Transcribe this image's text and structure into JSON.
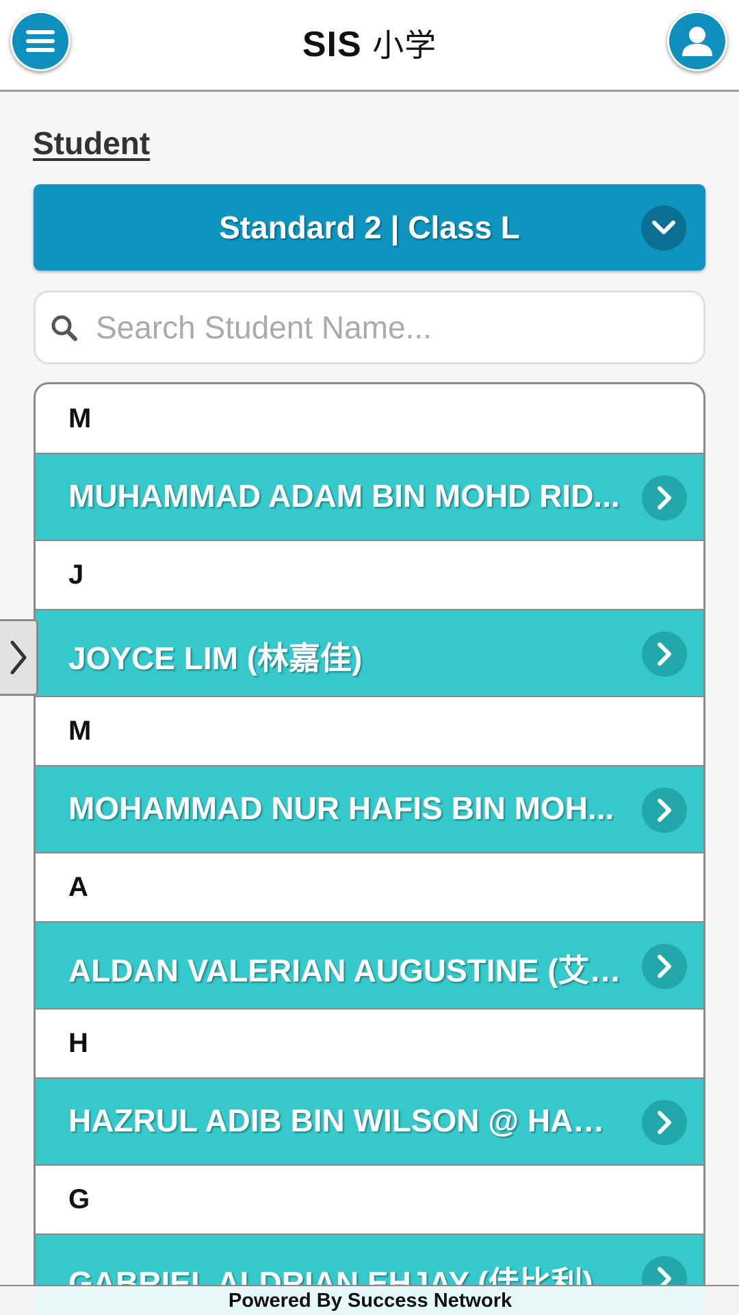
{
  "header": {
    "title_sis": "SIS",
    "title_cn": "小学",
    "menu_icon": "hamburger-menu-icon",
    "user_icon": "user-profile-icon"
  },
  "page": {
    "section_title": "Student"
  },
  "class_selector": {
    "selected": "Standard 2 | Class L",
    "icon": "chevron-down-icon"
  },
  "search": {
    "placeholder": "Search Student Name...",
    "value": "",
    "icon": "search-icon"
  },
  "students": [
    {
      "group": "M",
      "name": "MUHAMMAD ADAM BIN MOHD RID..."
    },
    {
      "group": "J",
      "name": "JOYCE LIM (林嘉佳)"
    },
    {
      "group": "M",
      "name": "MOHAMMAD NUR HAFIS BIN MOH..."
    },
    {
      "group": "A",
      "name": "ALDAN VALERIAN AUGUSTINE (艾邓)"
    },
    {
      "group": "H",
      "name": "HAZRUL ADIB BIN WILSON @ HAMI..."
    },
    {
      "group": "G",
      "name": "GABRIEL ALDRIAN EHJAY (佳比利)"
    }
  ],
  "footer": {
    "text": "Powered By Success Network"
  },
  "colors": {
    "primary": "#0f94c0",
    "row": "#35c9cb",
    "row_button": "#23a8aa"
  }
}
